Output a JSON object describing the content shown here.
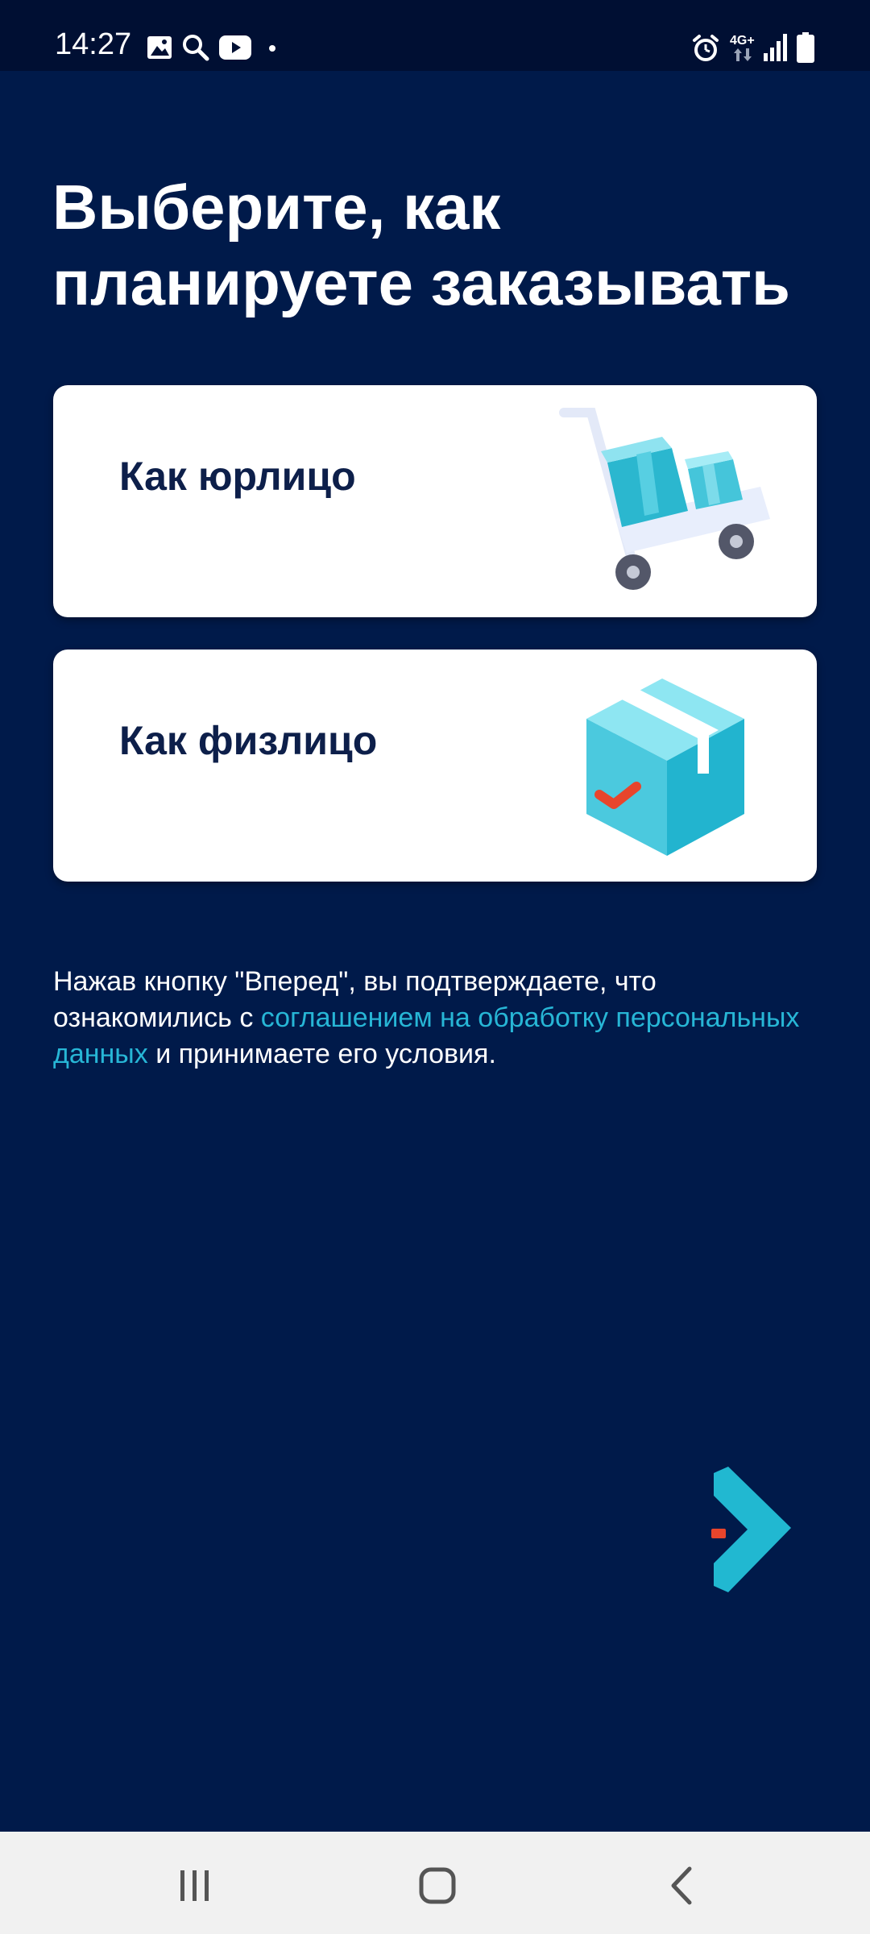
{
  "status_bar": {
    "time": "14:27",
    "network_label": "4G+"
  },
  "main": {
    "title": "Выберите, как планируете заказывать",
    "options": [
      {
        "label": "Как юрлицо",
        "illustration": "hand-truck-with-boxes-icon"
      },
      {
        "label": "Как физлицо",
        "illustration": "box-with-checkmark-icon"
      }
    ],
    "consent": {
      "text_before": "Нажав кнопку \"Вперед\", вы подтверждаете, что ознакомились с ",
      "link_text": "соглашением на обработку персональных данных",
      "text_after": " и принимаете его условия."
    },
    "next_button_icon": "chevron-right-icon"
  },
  "nav_bar": {
    "recent": "recent-apps-icon",
    "home": "home-icon",
    "back": "back-icon"
  },
  "colors": {
    "background": "#001a4a",
    "status_bar": "#000f33",
    "card": "#ffffff",
    "card_text": "#0d1f4a",
    "link": "#27b6d6",
    "accent_red": "#e8452c",
    "accent_teal": "#1fb7d1"
  }
}
